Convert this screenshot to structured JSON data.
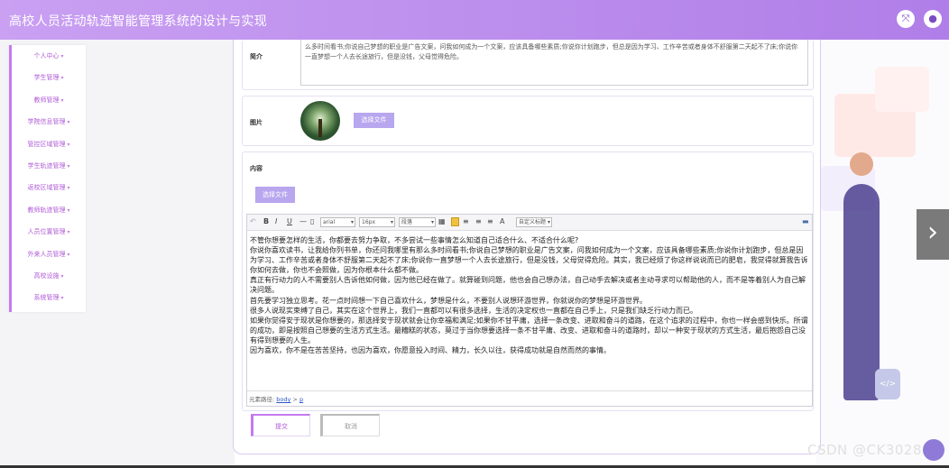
{
  "header": {
    "title": "高校人员活动轨迹智能管理系统的设计与实现",
    "fullscreen_icon": "fullscreen-icon",
    "user_icon": "user-icon"
  },
  "sidebar": {
    "items": [
      {
        "label": "个人中心"
      },
      {
        "label": "学生管理"
      },
      {
        "label": "教师管理"
      },
      {
        "label": "学院信息管理"
      },
      {
        "label": "管控区域管理"
      },
      {
        "label": "学生轨迹管理"
      },
      {
        "label": "返校区域管理"
      },
      {
        "label": "教师轨迹管理"
      },
      {
        "label": "人员位置管理"
      },
      {
        "label": "外来人员管理"
      },
      {
        "label": "高校设施"
      },
      {
        "label": "系统管理"
      }
    ]
  },
  "form": {
    "intro": {
      "label": "简介",
      "value": "么多时间看书;你说自己梦想的职业是广告文案，问我如何成为一个文案，应该具备哪些素质;你说你计划跑步，但总是因为学习、工作辛苦或者身体不舒服第二天起不了床;你说你一直梦想一个人去长途旅行，但是没钱，父母觉得危险。"
    },
    "image": {
      "label": "图片",
      "button": "选择文件"
    },
    "content": {
      "label": "内容",
      "button": "选择文件"
    }
  },
  "editor": {
    "toolbar": {
      "font": "arial",
      "size": "16px",
      "paragraph": "段落",
      "custom": "自定义标题"
    },
    "paragraphs": [
      "不管你想要怎样的生活，你都要去努力争取，不多尝试一些事情怎么知道自己适合什么、不适合什么呢?",
      "你说你喜欢读书，让我给你列书单，你还问我哪里有那么多时间看书;你说自己梦想的职业是广告文案，问我如何成为一个文案，应该具备哪些素质;你说你计划跑步，但总是因为学习、工作辛苦或者身体不舒服第二天起不了床;你说你一直梦想一个人去长途旅行，但是没钱，父母觉得危险。其实，我已经烦了你这样说说而已的肥皂，我觉得就算我告诉你如何去做，你也不会照做，因为你根本什么都不做。",
      "真正有行动力的人不需要别人告诉他如何做，因为他已经在做了。就算碰到问题，他也会自己想办法，自己动手去解决或者主动寻求可以帮助他的人，而不是等着别人为自己解决问题。",
      "首先要学习独立思考。花一点时间想一下自己喜欢什么，梦想是什么，不要别人说想环游世界，你就说你的梦想是环游世界。",
      "很多人说现实束缚了自己，其实在这个世界上，我们一直都可以有很多选择，生活的决定权也一直都在自己手上，只是我们缺乏行动力而已。",
      "如果你觉得安于现状是你想要的，那选择安于现状就会让你幸福和满足;如果你不甘平庸，选择一条改变、进取和奋斗的道路，在这个追求的过程中，你也一样会感到快乐。所谓的成功，即是按照自己想要的生活方式生活。最糟糕的状态，莫过于当你想要选择一条不甘平庸、改变、进取和奋斗的道路时，却以一种安于现状的方式生活，最后抱怨自己没有得到想要的人生。",
      "因为喜欢，你不是在苦苦坚持，也因为喜欢，你愿意投入时间、精力，长久以往，获得成功就是自然而然的事情。"
    ],
    "path_prefix": "元素路径:",
    "path_body": "body",
    "path_sep": ">",
    "path_p": "p"
  },
  "actions": {
    "submit": "提交",
    "cancel": "取消"
  },
  "watermark": "CSDN @CK3028",
  "colors": {
    "header_gradient_start": "#c9a0f2",
    "header_gradient_end": "#b07ee8",
    "accent": "#c57af0",
    "button_purple": "#b8a6ee"
  }
}
